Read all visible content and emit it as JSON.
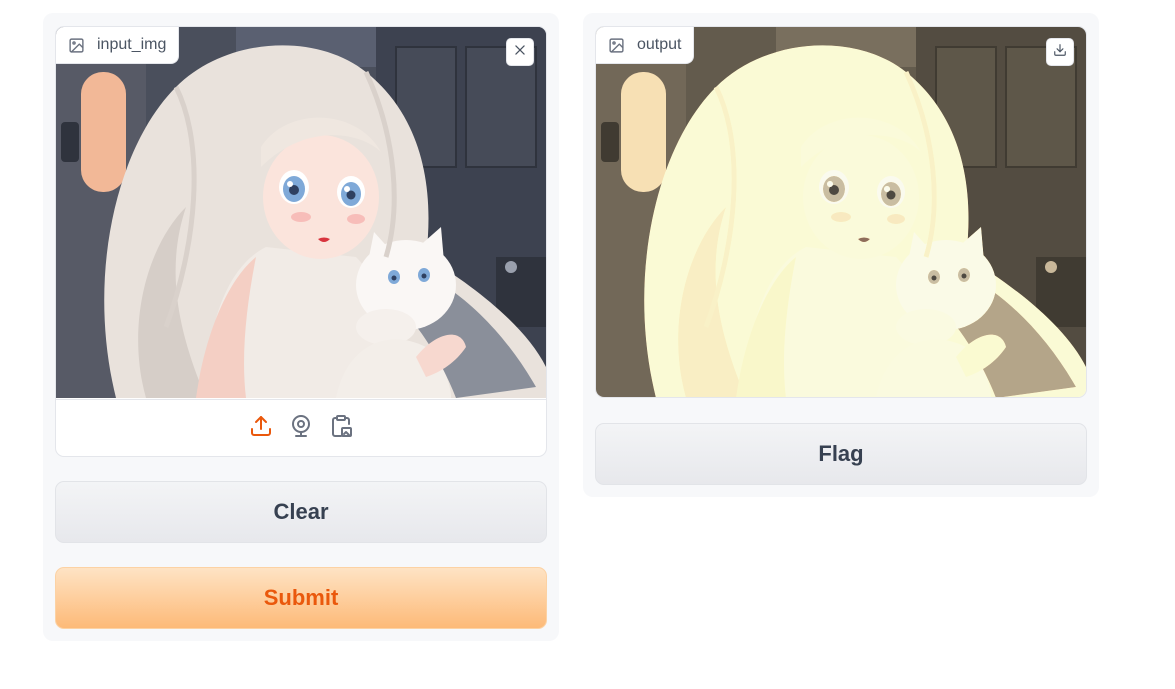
{
  "input": {
    "label": "input_img",
    "icons": {
      "label": "image-icon",
      "clear": "close-icon",
      "sources": [
        "upload-icon",
        "webcam-icon",
        "clipboard-icon"
      ]
    }
  },
  "output": {
    "label": "output",
    "icons": {
      "label": "image-icon",
      "download": "download-icon"
    }
  },
  "buttons": {
    "clear": "Clear",
    "submit": "Submit",
    "flag": "Flag"
  },
  "colors": {
    "accent": "#ea580c",
    "primary_gradient_top": "#fee3c4",
    "primary_gradient_bottom": "#fdba78",
    "panel_bg": "#f7f8fa",
    "border": "#e4e6eb"
  }
}
